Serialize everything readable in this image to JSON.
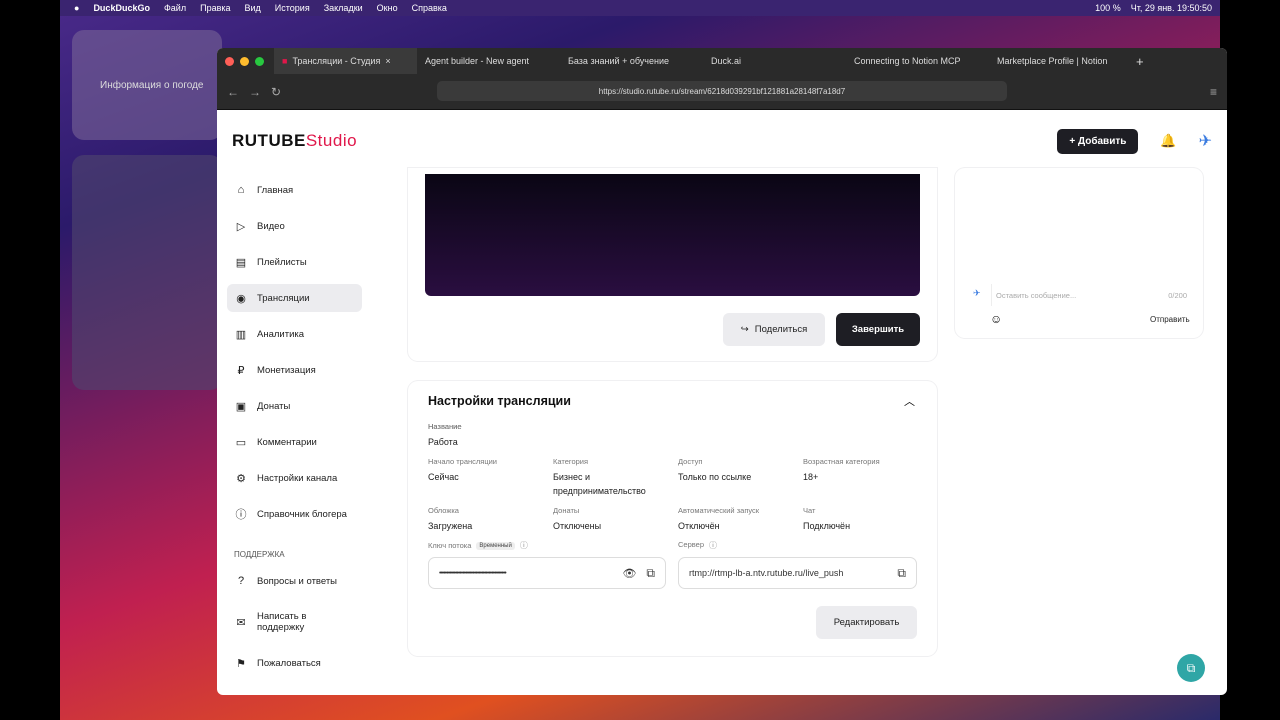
{
  "menubar": {
    "app": "DuckDuckGo",
    "items": [
      "Файл",
      "Правка",
      "Вид",
      "История",
      "Закладки",
      "Окно",
      "Справка"
    ],
    "battery": "100 %",
    "datetime": "Чт, 29 янв. 19:50:50"
  },
  "desktop": {
    "weather_widget": "Информация о погоде"
  },
  "browser": {
    "tabs": [
      "Трансляции - Студия",
      "Agent builder - New agent",
      "База знаний + обучение",
      "Duck.ai",
      "Connecting to Notion MCP",
      "Marketplace Profile | Notion"
    ],
    "url": "https://studio.rutube.ru/stream/6218d039291bf121881a28148f7a18d7"
  },
  "header": {
    "logo": "RUTUBE",
    "logo_suffix": "Studio",
    "add": "Добавить"
  },
  "sidebar": {
    "items": [
      "Главная",
      "Видео",
      "Плейлисты",
      "Трансляции",
      "Аналитика",
      "Монетизация",
      "Донаты",
      "Комментарии",
      "Настройки канала",
      "Справочник блогера"
    ],
    "support_title": "ПОДДЕРЖКА",
    "support": [
      "Вопросы и ответы",
      "Написать в поддержку",
      "Пожаловаться"
    ]
  },
  "stream": {
    "share": "Поделиться",
    "finish": "Завершить"
  },
  "chat": {
    "placeholder": "Оставить сообщение...",
    "counter": "0/200",
    "send": "Отправить"
  },
  "settings": {
    "title": "Настройки трансляции",
    "name_label": "Название",
    "name": "Работа",
    "fields": [
      {
        "label": "Начало трансляции",
        "value": "Сейчас"
      },
      {
        "label": "Категория",
        "value": "Бизнес и предпринимательство"
      },
      {
        "label": "Доступ",
        "value": "Только по ссылке"
      },
      {
        "label": "Возрастная категория",
        "value": "18+"
      },
      {
        "label": "Обложка",
        "value": "Загружена"
      },
      {
        "label": "Донаты",
        "value": "Отключены"
      },
      {
        "label": "Автоматический запуск",
        "value": "Отключён"
      },
      {
        "label": "Чат",
        "value": "Подключён"
      }
    ],
    "key_label": "Ключ потока",
    "key_badge": "Временный",
    "key_value": "••••••••••••••••••••••••••••••••••••••••••••••",
    "server_label": "Сервер",
    "server_value": "rtmp://rtmp-lb-a.ntv.rutube.ru/live_push",
    "edit": "Редактировать"
  }
}
